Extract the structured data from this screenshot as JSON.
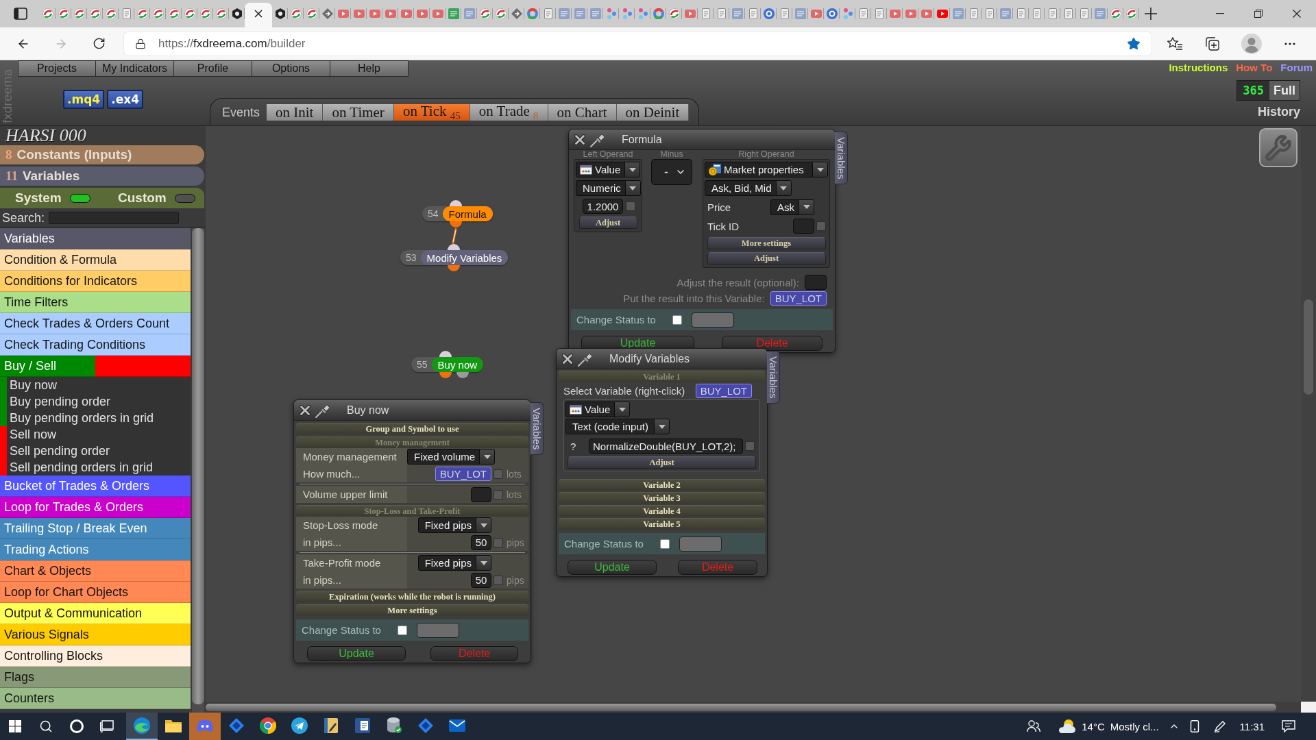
{
  "browser": {
    "tabs": [
      {
        "kind": "swirl",
        "selected": false
      },
      {
        "kind": "swirl",
        "selected": false
      },
      {
        "kind": "swirl",
        "selected": false
      },
      {
        "kind": "swirl",
        "selected": false
      },
      {
        "kind": "swirl",
        "selected": false
      },
      {
        "kind": "page",
        "selected": false
      },
      {
        "kind": "swirl",
        "selected": false
      },
      {
        "kind": "swirl",
        "selected": false
      },
      {
        "kind": "swirl",
        "selected": false
      },
      {
        "kind": "swirl",
        "selected": false
      },
      {
        "kind": "swirl",
        "selected": false
      },
      {
        "kind": "swirl",
        "selected": false
      },
      {
        "kind": "hexagon",
        "selected": false
      },
      {
        "selected": true
      },
      {
        "kind": "hexagon",
        "selected": false
      },
      {
        "kind": "swirl",
        "selected": false
      },
      {
        "kind": "swirl",
        "selected": false
      },
      {
        "kind": "diamond",
        "selected": false
      },
      {
        "kind": "play",
        "selected": false
      },
      {
        "kind": "play",
        "selected": false
      },
      {
        "kind": "play",
        "selected": false
      },
      {
        "kind": "play",
        "selected": false
      },
      {
        "kind": "play",
        "selected": false
      },
      {
        "kind": "play",
        "selected": false
      },
      {
        "kind": "play",
        "selected": false
      },
      {
        "kind": "tile-green",
        "selected": false
      },
      {
        "kind": "tile",
        "selected": false
      },
      {
        "kind": "swirl",
        "selected": false
      },
      {
        "kind": "swirl",
        "selected": false
      },
      {
        "kind": "diamond",
        "selected": false
      },
      {
        "kind": "ring",
        "selected": false
      },
      {
        "kind": "page",
        "selected": false
      },
      {
        "kind": "tile",
        "selected": false
      },
      {
        "kind": "tile",
        "selected": false
      },
      {
        "kind": "tile",
        "selected": false
      },
      {
        "kind": "dots",
        "selected": false
      },
      {
        "kind": "dots",
        "selected": false
      },
      {
        "kind": "dots",
        "selected": false
      },
      {
        "kind": "ring",
        "selected": false
      },
      {
        "kind": "swirl",
        "selected": false
      },
      {
        "kind": "play",
        "selected": false
      },
      {
        "kind": "page",
        "selected": false
      },
      {
        "kind": "page",
        "selected": false
      },
      {
        "kind": "tile",
        "selected": false
      },
      {
        "kind": "page",
        "selected": false
      },
      {
        "kind": "disc",
        "selected": false
      },
      {
        "kind": "page",
        "selected": false
      },
      {
        "kind": "tile",
        "selected": false
      },
      {
        "kind": "play",
        "selected": false
      },
      {
        "kind": "disc",
        "selected": false
      },
      {
        "kind": "dots",
        "selected": false
      },
      {
        "kind": "page",
        "selected": false
      },
      {
        "kind": "page",
        "selected": false
      },
      {
        "kind": "play",
        "selected": false
      },
      {
        "kind": "play",
        "selected": false
      },
      {
        "kind": "play",
        "selected": false
      },
      {
        "kind": "play-live",
        "selected": false
      },
      {
        "kind": "tile",
        "selected": false
      },
      {
        "kind": "page",
        "selected": false
      },
      {
        "kind": "page",
        "selected": false
      },
      {
        "kind": "tile",
        "selected": false
      },
      {
        "kind": "page",
        "selected": false
      },
      {
        "kind": "page",
        "selected": false
      },
      {
        "kind": "page",
        "selected": false
      },
      {
        "kind": "page",
        "selected": false
      },
      {
        "kind": "page",
        "selected": false
      },
      {
        "kind": "tile",
        "selected": false
      },
      {
        "kind": "swirl",
        "selected": false
      },
      {
        "kind": "swirl",
        "selected": false
      }
    ],
    "address": {
      "scheme": "https://",
      "host": "fxdreema.com",
      "path": "/builder"
    },
    "favorite": true
  },
  "header": {
    "brand": "fxdreema",
    "menu": [
      "Projects",
      "My Indicators",
      "Profile",
      "Options",
      "Help"
    ],
    "exports": [
      {
        "label": ".mq4",
        "kind": "source"
      },
      {
        "label": ".ex4",
        "kind": "compiled"
      }
    ],
    "events": {
      "label": "Events",
      "tabs": [
        {
          "label": "on Init",
          "selected": false
        },
        {
          "label": "on Timer",
          "selected": false
        },
        {
          "label": "on Tick",
          "count": "45",
          "selected": true
        },
        {
          "label": "on Trade",
          "count": "8",
          "selected": false
        },
        {
          "label": "on Chart",
          "selected": false
        },
        {
          "label": "on Deinit",
          "selected": false
        }
      ]
    },
    "links": [
      {
        "label": "Instructions",
        "color": "#ccff33"
      },
      {
        "label": "How To",
        "color": "#ff6644"
      },
      {
        "label": "Forum",
        "color": "#9999ff"
      }
    ],
    "plan": {
      "days": "365",
      "label": "Full"
    },
    "history": "History"
  },
  "sidebar": {
    "project": "HARSI 000",
    "constants": {
      "count": "8",
      "label": "Constants (Inputs)"
    },
    "variables": {
      "count": "11",
      "label": "Variables"
    },
    "toggles": [
      {
        "label": "System",
        "on": true
      },
      {
        "label": "Custom",
        "on": false
      }
    ],
    "search": {
      "label": "Search:"
    },
    "categories": [
      {
        "label": "Variables",
        "color": "#575768"
      },
      {
        "label": "Condition & Formula",
        "color": "#ffddaa"
      },
      {
        "label": "Conditions for Indicators",
        "color": "#ffcc66"
      },
      {
        "label": "Time Filters",
        "color": "#aade88"
      },
      {
        "label": "Check Trades & Orders Count",
        "color": "#aaccff"
      },
      {
        "label": "Check Trading Conditions",
        "color": "#aaccff"
      },
      {
        "label": "Buy / Sell",
        "segments": [
          {
            "color": "#008800"
          },
          {
            "color": "#ff0000"
          }
        ],
        "children": [
          {
            "label": "Buy now",
            "color": "#008800"
          },
          {
            "label": "Buy pending order",
            "color": "#008800"
          },
          {
            "label": "Buy pending orders in grid",
            "color": "#008800"
          },
          {
            "label": "Sell now",
            "color": "#ff0000"
          },
          {
            "label": "Sell pending order",
            "color": "#ff0000"
          },
          {
            "label": "Sell pending orders in grid",
            "color": "#ff0000"
          }
        ]
      },
      {
        "label": "Bucket of Trades & Orders",
        "color": "#5555ff"
      },
      {
        "label": "Loop for Trades & Orders",
        "color": "#cc00cc"
      },
      {
        "label": "Trailing Stop / Break Even",
        "color": "#4488bb"
      },
      {
        "label": "Trading Actions",
        "color": "#4488bb"
      },
      {
        "label": "Chart & Objects",
        "color": "#ff8855"
      },
      {
        "label": "Loop for Chart Objects",
        "color": "#ff8855"
      },
      {
        "label": "Output & Communication",
        "color": "#ffff55"
      },
      {
        "label": "Various Signals",
        "color": "#ffcc00"
      },
      {
        "label": "Controlling Blocks",
        "color": "#ffeedd"
      },
      {
        "label": "Flags",
        "color": "#889977"
      },
      {
        "label": "Counters",
        "color": "#99bb88"
      }
    ]
  },
  "canvas": {
    "blocks": [
      {
        "number": "54",
        "label": "Formula",
        "color": "#ff8c00"
      },
      {
        "number": "53",
        "label": "Modify Variables",
        "color": "#62627a"
      },
      {
        "number": "55",
        "label": "Buy now",
        "color": "#119911"
      }
    ],
    "formula": {
      "title": "Formula",
      "side_tab": "Variables",
      "left": {
        "heading": "Left Operand",
        "type": "Value",
        "format": "Numeric",
        "value": "1.2000",
        "checked": false,
        "button": "Adjust"
      },
      "operator": {
        "heading": "Minus",
        "value": "-"
      },
      "right": {
        "heading": "Right Operand",
        "type": "Market properties",
        "group": "Ask, Bid, Mid",
        "fields": [
          {
            "label": "Price",
            "kind": "select",
            "value": "Ask"
          },
          {
            "label": "Tick ID",
            "kind": "input",
            "checked": false
          }
        ],
        "buttons": [
          "More settings",
          "Adjust"
        ]
      },
      "result": [
        {
          "label": "Adjust the result (optional):",
          "kind": "input"
        },
        {
          "label": "Put the result into this Variable:",
          "kind": "variable",
          "value": "BUY_LOT"
        }
      ],
      "status": {
        "label": "Change Status to",
        "checked": false
      },
      "actions": [
        {
          "label": "Update",
          "kind": "update"
        },
        {
          "label": "Delete",
          "kind": "delete"
        }
      ]
    },
    "modify": {
      "title": "Modify Variables",
      "side_tab": "Variables",
      "variables": [
        {
          "label": "Variable 1",
          "expanded": true,
          "select_label": "Select Variable (right-click)",
          "variable": "BUY_LOT",
          "type": "Value",
          "format": "Text (code input)",
          "hint": "?",
          "code": "NormalizeDouble(BUY_LOT,2);",
          "checked": false,
          "button": "Adjust"
        },
        {
          "label": "Variable 2",
          "expanded": false
        },
        {
          "label": "Variable 3",
          "expanded": false
        },
        {
          "label": "Variable 4",
          "expanded": false
        },
        {
          "label": "Variable 5",
          "expanded": false
        }
      ],
      "status": {
        "label": "Change Status to",
        "checked": false
      },
      "actions": [
        {
          "label": "Update",
          "kind": "update"
        },
        {
          "label": "Delete",
          "kind": "delete"
        }
      ]
    },
    "buy": {
      "title": "Buy now",
      "side_tab": "Variables",
      "sections": [
        {
          "label": "Group and Symbol to use",
          "expanded": false
        },
        {
          "label": "Money management",
          "expanded": true,
          "groups": [
            {
              "rows": [
                {
                  "label": "Money management",
                  "kind": "select",
                  "value": "Fixed volume"
                },
                {
                  "label": "How much...",
                  "kind": "variable",
                  "value": "BUY_LOT",
                  "checked": false,
                  "unit": "lots"
                }
              ]
            },
            {
              "rows": [
                {
                  "label": "Volume upper limit",
                  "kind": "input",
                  "checked": false,
                  "unit": "lots"
                }
              ]
            }
          ]
        },
        {
          "label": "Stop-Loss and Take-Profit",
          "expanded": true,
          "groups": [
            {
              "rows": [
                {
                  "label": "Stop-Loss mode",
                  "kind": "select",
                  "value": "Fixed pips"
                },
                {
                  "label": "in pips...",
                  "kind": "input",
                  "value": "50",
                  "checked": false,
                  "unit": "pips"
                }
              ]
            },
            {
              "rows": [
                {
                  "label": "Take-Profit mode",
                  "kind": "select",
                  "value": "Fixed pips"
                },
                {
                  "label": "in pips...",
                  "kind": "input",
                  "value": "50",
                  "checked": false,
                  "unit": "pips"
                }
              ]
            }
          ]
        },
        {
          "label": "Expiration (works while the robot is running)",
          "expanded": false
        },
        {
          "label": "More settings",
          "expanded": false
        }
      ],
      "status": {
        "label": "Change Status to",
        "checked": false
      },
      "actions": [
        {
          "label": "Update",
          "kind": "update"
        },
        {
          "label": "Delete",
          "kind": "delete"
        }
      ]
    }
  },
  "taskbar": {
    "apps": [
      {
        "kind": "browser",
        "selected": true,
        "attention": false
      },
      {
        "kind": "folder",
        "selected": false,
        "attention": false
      },
      {
        "kind": "chat",
        "selected": false,
        "attention": true
      },
      {
        "kind": "diamond",
        "selected": false,
        "attention": false
      },
      {
        "kind": "ring",
        "selected": false,
        "attention": false
      },
      {
        "kind": "plane",
        "selected": false,
        "attention": false
      },
      {
        "kind": "book",
        "selected": false,
        "attention": false
      },
      {
        "kind": "document",
        "selected": false,
        "attention": false
      },
      {
        "kind": "database",
        "selected": false,
        "attention": false
      },
      {
        "kind": "diamond",
        "selected": false,
        "attention": false
      },
      {
        "kind": "mail",
        "selected": false,
        "attention": false
      }
    ],
    "temperature": "14°C",
    "weather": "Mostly cl...",
    "time": "11:31"
  }
}
